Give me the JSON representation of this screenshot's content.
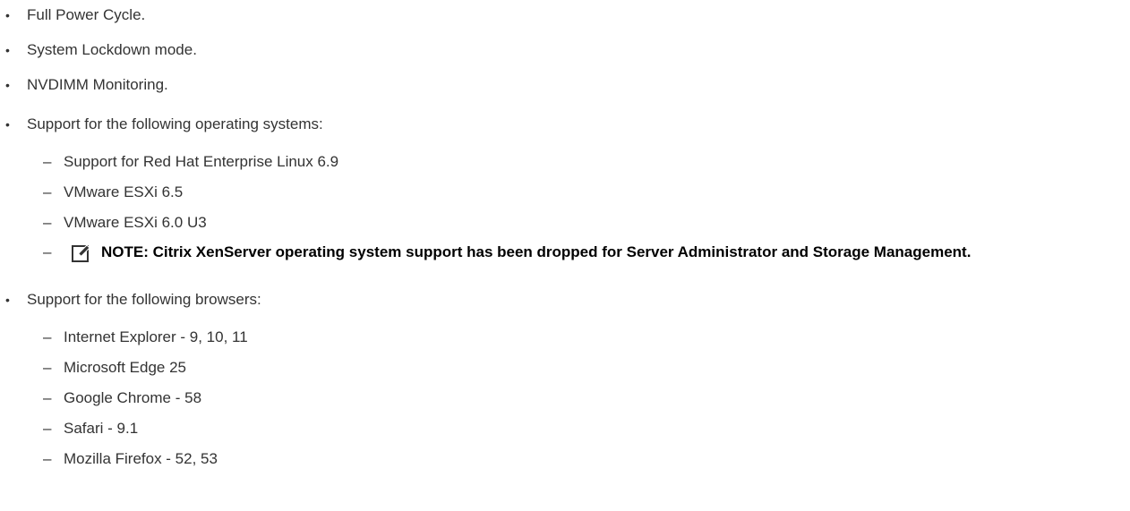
{
  "bullets_top": [
    "Full Power Cycle.",
    "System Lockdown mode.",
    "NVDIMM Monitoring."
  ],
  "os_section": {
    "heading": "Support for the following operating systems:",
    "items": [
      "Support for Red Hat Enterprise Linux 6.9",
      "VMware ESXi 6.5",
      "VMware ESXi 6.0 U3"
    ],
    "note": "NOTE: Citrix XenServer operating system support has been dropped for Server Administrator and Storage Management.",
    "note_icon": "pencil-note-icon"
  },
  "browser_section": {
    "heading": "Support for the following browsers:",
    "items": [
      "Internet Explorer - 9, 10, 11",
      "Microsoft Edge 25",
      "Google Chrome - 58",
      "Safari - 9.1",
      "Mozilla Firefox - 52, 53"
    ]
  },
  "glyphs": {
    "bullet": "•",
    "dash": "–"
  }
}
